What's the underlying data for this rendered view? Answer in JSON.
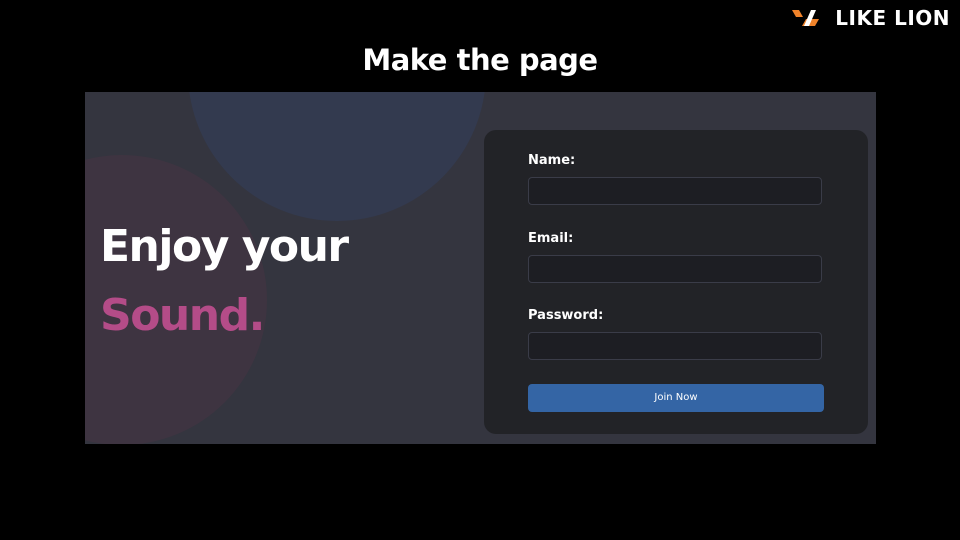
{
  "brand": {
    "logo_text": "LIKE LION",
    "logo_icon": "likelion-bracket-mark",
    "colors": {
      "accent": "#f0832a",
      "text": "#ffffff"
    }
  },
  "slide": {
    "title": "Make the page",
    "background": "#000000"
  },
  "page": {
    "hero": {
      "line1": "Enjoy your",
      "line2": "Sound."
    },
    "form": {
      "name_label": "Name:",
      "name_value": "",
      "email_label": "Email:",
      "email_value": "",
      "password_label": "Password:",
      "password_value": "",
      "submit_label": "Join Now"
    },
    "colors": {
      "page_bg": "#34353f",
      "card_bg": "#222327",
      "input_bg": "#1d1e23",
      "button": "#3465a5",
      "hero_accent": "#b44c88",
      "blob_blue": "#333a4f",
      "blob_pink": "#3e3441"
    }
  }
}
